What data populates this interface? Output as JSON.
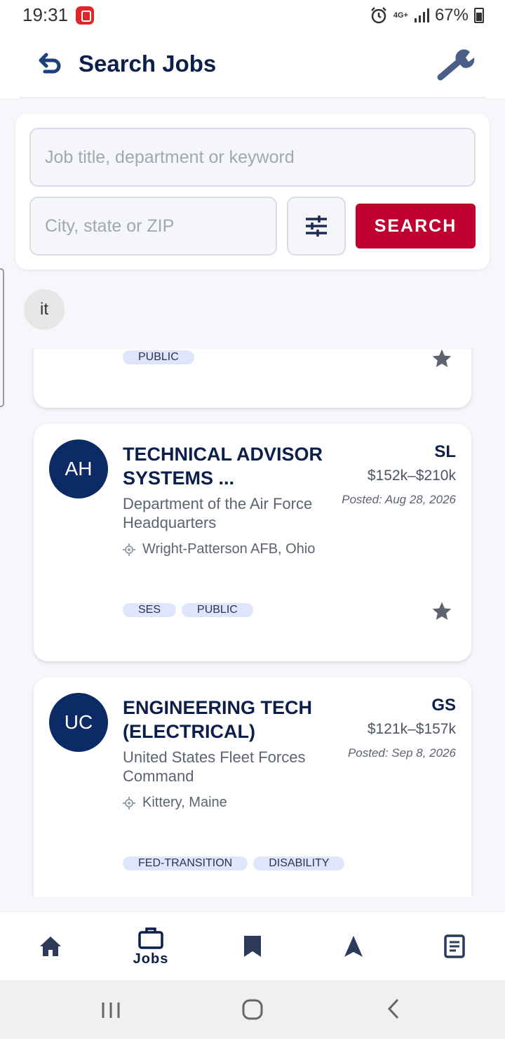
{
  "status_bar": {
    "time": "19:31",
    "network": "4G+",
    "battery": "67%"
  },
  "header": {
    "title": "Search Jobs"
  },
  "search": {
    "keyword_placeholder": "Job title, department or keyword",
    "location_placeholder": "City, state or ZIP",
    "search_label": "SEARCH"
  },
  "query_chip": "it",
  "partial_card": {
    "tags": [
      "PUBLIC"
    ]
  },
  "jobs": [
    {
      "initials": "AH",
      "title": "TECHNICAL ADVISOR SYSTEMS ...",
      "grade": "SL",
      "salary": "$152k–$210k",
      "posted": "Posted: Aug 28, 2026",
      "department": "Department of the Air Force Headquarters",
      "location": "Wright-Patterson AFB, Ohio",
      "tags": [
        "SES",
        "PUBLIC"
      ]
    },
    {
      "initials": "UC",
      "title": "ENGINEERING TECH (ELECTRICAL)",
      "grade": "GS",
      "salary": "$121k–$157k",
      "posted": "Posted: Sep 8, 2026",
      "department": "United States Fleet Forces Command",
      "location": "Kittery, Maine",
      "tags": [
        "FED-TRANSITION",
        "DISABILITY"
      ]
    }
  ],
  "bottom_nav": [
    {
      "icon": "home-icon",
      "label": ""
    },
    {
      "icon": "briefcase-icon",
      "label": "Jobs"
    },
    {
      "icon": "bookmark-icon",
      "label": ""
    },
    {
      "icon": "navigation-icon",
      "label": ""
    },
    {
      "icon": "document-icon",
      "label": ""
    }
  ],
  "colors": {
    "primary_navy": "#0b2a66",
    "accent_red": "#c0002e",
    "tag_bg": "#dfe6fb"
  }
}
